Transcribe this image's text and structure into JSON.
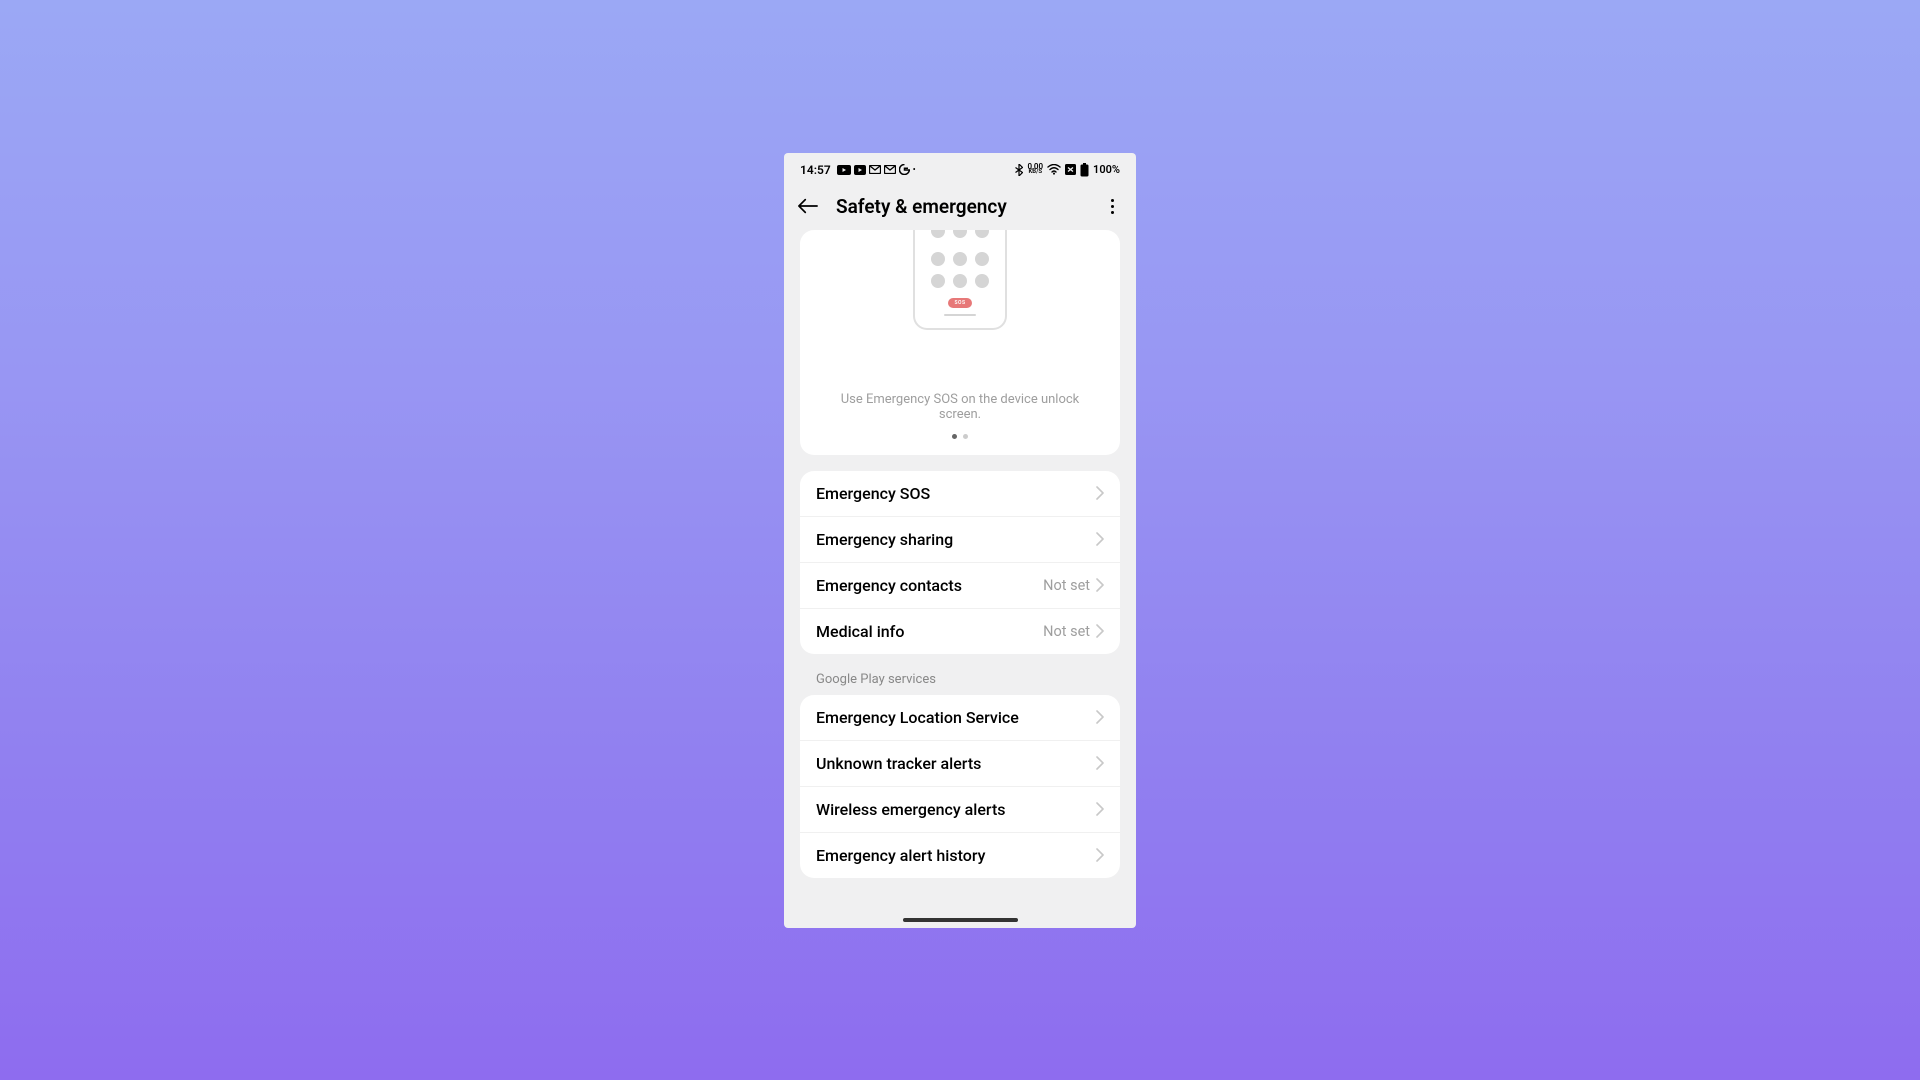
{
  "status": {
    "time": "14:57",
    "data_rate": "0,00",
    "data_unit": "KB/S",
    "battery": "100%"
  },
  "appbar": {
    "title": "Safety & emergency"
  },
  "hero": {
    "caption": "Use Emergency SOS on the device unlock screen.",
    "sos_label": "SOS"
  },
  "group1": {
    "items": [
      {
        "label": "Emergency SOS",
        "value": ""
      },
      {
        "label": "Emergency sharing",
        "value": ""
      },
      {
        "label": "Emergency contacts",
        "value": "Not set"
      },
      {
        "label": "Medical info",
        "value": "Not set"
      }
    ]
  },
  "section2_header": "Google Play services",
  "group2": {
    "items": [
      {
        "label": "Emergency Location Service",
        "value": ""
      },
      {
        "label": "Unknown tracker alerts",
        "value": ""
      },
      {
        "label": "Wireless emergency alerts",
        "value": ""
      },
      {
        "label": "Emergency alert history",
        "value": ""
      }
    ]
  }
}
